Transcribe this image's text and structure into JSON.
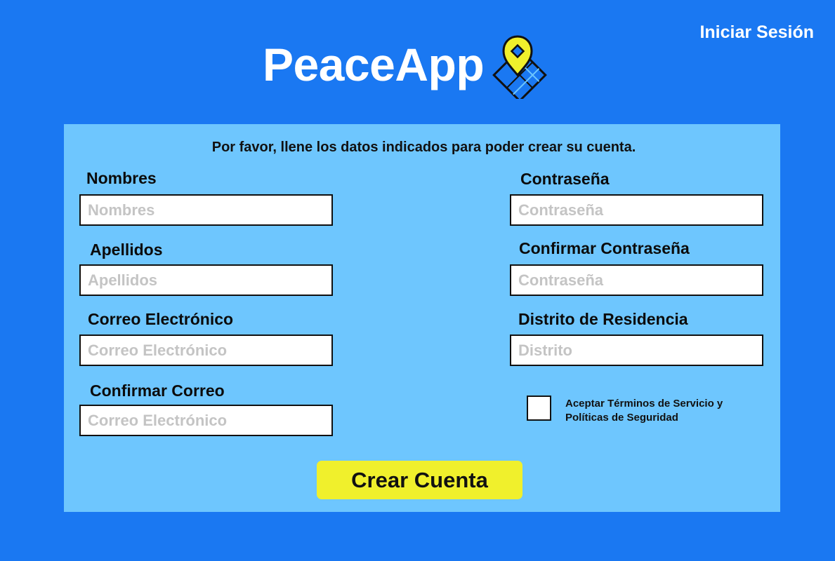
{
  "header": {
    "login_link": "Iniciar Sesión",
    "brand_name": "PeaceApp",
    "logo_icon": "map-pin-icon",
    "colors": {
      "background": "#1a78f2",
      "logo_pin": "#f0f02c",
      "logo_map": "#1a78f2"
    }
  },
  "form": {
    "intro": "Por favor, llene los datos indicados para poder crear su cuenta.",
    "names": {
      "label": "Nombres",
      "placeholder": "Nombres"
    },
    "surnames": {
      "label": "Apellidos",
      "placeholder": "Apellidos"
    },
    "email": {
      "label": "Correo Electrónico",
      "placeholder": "Correo Electrónico"
    },
    "confirm_email": {
      "label": "Confirmar Correo",
      "placeholder": "Correo Electrónico"
    },
    "password": {
      "label": "Contraseña",
      "placeholder": "Contraseña"
    },
    "confirm_password": {
      "label": "Confirmar Contraseña",
      "placeholder": "Contraseña"
    },
    "district": {
      "label": "Distrito de Residencia",
      "placeholder": "Distrito"
    },
    "terms": {
      "line1": "Aceptar Términos de Servicio y",
      "line2": "Políticas de Seguridad",
      "checked": false
    },
    "submit_label": "Crear Cuenta",
    "colors": {
      "panel": "#6ec6fe",
      "button": "#f0f02c"
    }
  }
}
